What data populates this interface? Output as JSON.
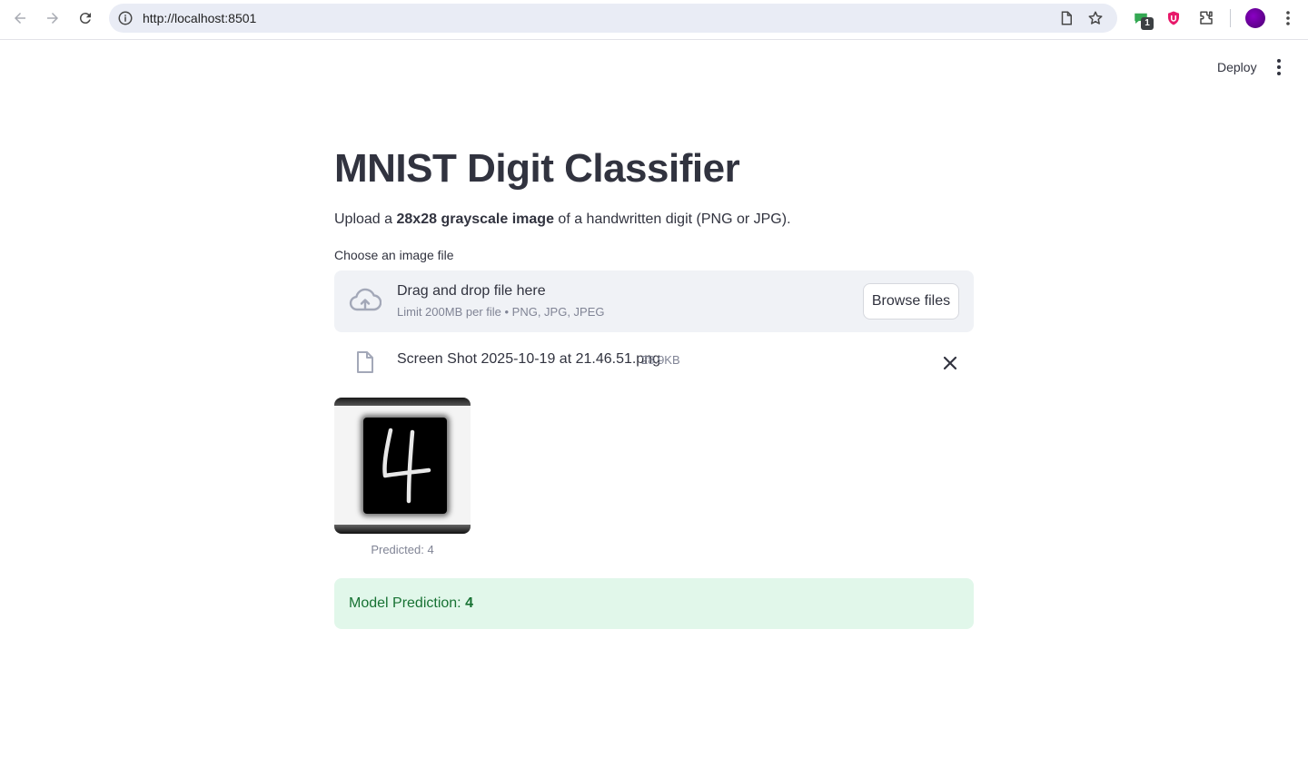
{
  "browser": {
    "url": "http://localhost:8501",
    "extension_badge": "1"
  },
  "header": {
    "deploy_label": "Deploy"
  },
  "app": {
    "title": "MNIST Digit Classifier",
    "intro_prefix": "Upload a ",
    "intro_bold": "28x28 grayscale image",
    "intro_suffix": " of a handwritten digit (PNG or JPG).",
    "uploader": {
      "label": "Choose an image file",
      "drop_title": "Drag and drop file here",
      "limit_text": "Limit 200MB per file • PNG, JPG, JPEG",
      "browse_label": "Browse files",
      "icon": "cloud-upload-icon"
    },
    "uploaded_file": {
      "name": "Screen Shot 2025-10-19 at 21.46.51.png",
      "size": "28.9KB",
      "icon": "file-icon"
    },
    "image_caption": "Predicted: 4",
    "digit_shown": "4",
    "result": {
      "prefix": "Model Prediction: ",
      "value": "4"
    }
  },
  "colors": {
    "success_bg": "#e1f7ea",
    "success_text": "#177233",
    "dropzone_bg": "#f0f2f6",
    "text": "#31333f",
    "muted": "#808495"
  }
}
